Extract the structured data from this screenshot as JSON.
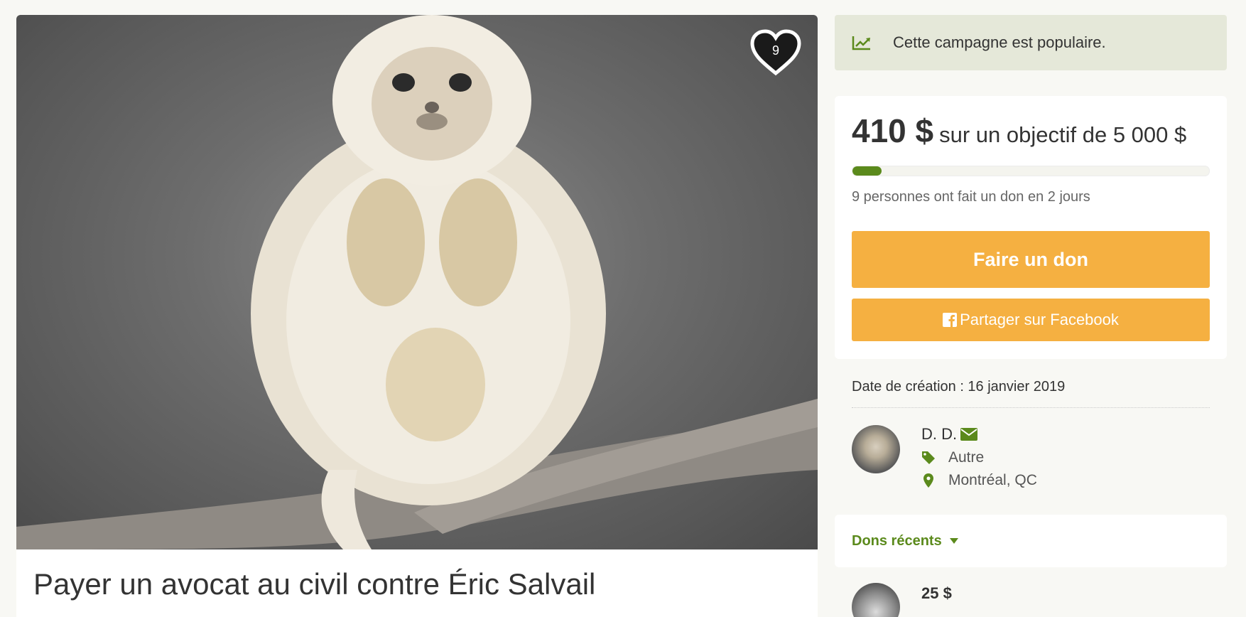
{
  "photo": {
    "subject": "monkey-photo",
    "favorites_count": "9"
  },
  "campaign": {
    "title": "Payer un avocat au civil contre Éric Salvail"
  },
  "popular": {
    "icon": "trending-up-icon",
    "text": "Cette campagne est populaire."
  },
  "funds": {
    "raised": "410 $",
    "goal_text": "sur un objectif de 5 000 $",
    "progress_fraction": 0.082,
    "donors_text": "9 personnes ont fait un don en 2 jours",
    "donate_label": "Faire un don",
    "share_label": "Partager sur Facebook"
  },
  "meta": {
    "created": "Date de création : 16 janvier 2019",
    "owner_name": "D. D.",
    "category": "Autre",
    "location": "Montréal, QC"
  },
  "recent": {
    "label": "Dons récents",
    "donations": [
      {
        "amount": "25 $"
      }
    ]
  },
  "colors": {
    "accent_green": "#5b8a1c",
    "button_orange": "#f5b041",
    "popular_bg": "#e5e8d9"
  }
}
